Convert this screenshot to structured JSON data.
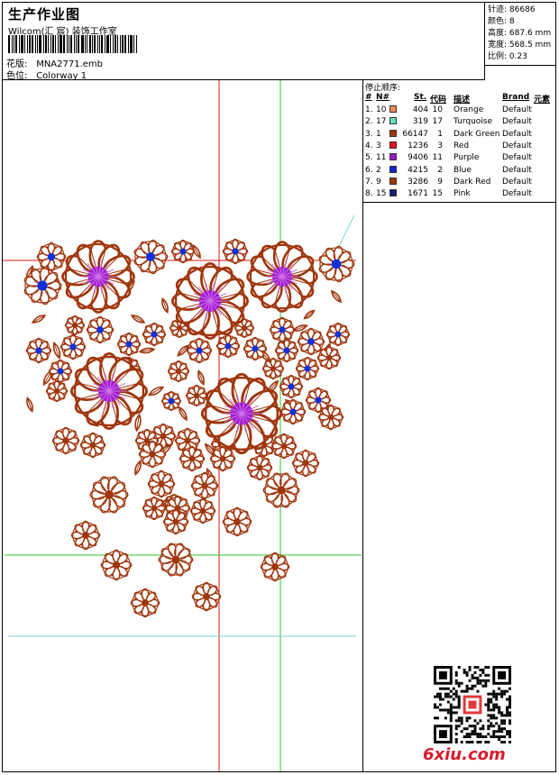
{
  "header": {
    "title": "生产作业图",
    "company": "Wilcom(汇 宸) 装饰工作室",
    "design_label": "花版:",
    "design_value": "MNA2771.emb",
    "colorway_label": "色位:",
    "colorway_value": "Colorway 1"
  },
  "stats": [
    {
      "label": "针迹:",
      "value": "86686"
    },
    {
      "label": "颜色:",
      "value": "8"
    },
    {
      "label": "高度:",
      "value": "687.6 mm"
    },
    {
      "label": "宽度:",
      "value": "568.5 mm"
    },
    {
      "label": "比例:",
      "value": "0.23"
    }
  ],
  "sequence": {
    "title": "停止顺序:",
    "headers": {
      "num": "#",
      "no": "N#",
      "st": "St.",
      "code": "代码",
      "desc": "描述",
      "brand": "Brand",
      "element": "元素"
    },
    "rows": [
      {
        "idx": "1.",
        "no": "10",
        "color": "#f08a5d",
        "st": "404",
        "code": "10",
        "desc": "Orange",
        "brand": "Default"
      },
      {
        "idx": "2.",
        "no": "17",
        "color": "#5fe0c0",
        "st": "319",
        "code": "17",
        "desc": "Turquoise",
        "brand": "Default"
      },
      {
        "idx": "3.",
        "no": "1",
        "color": "#a0360e",
        "st": "66147",
        "code": "1",
        "desc": "Dark Green",
        "brand": "Default"
      },
      {
        "idx": "4.",
        "no": "3",
        "color": "#e8101a",
        "st": "1236",
        "code": "3",
        "desc": "Red",
        "brand": "Default"
      },
      {
        "idx": "5.",
        "no": "11",
        "color": "#9a17c8",
        "st": "9406",
        "code": "11",
        "desc": "Purple",
        "brand": "Default"
      },
      {
        "idx": "6.",
        "no": "2",
        "color": "#1022d8",
        "st": "4215",
        "code": "2",
        "desc": "Blue",
        "brand": "Default"
      },
      {
        "idx": "7.",
        "no": "9",
        "color": "#a0360e",
        "st": "3286",
        "code": "9",
        "desc": "Dark Red",
        "brand": "Default"
      },
      {
        "idx": "8.",
        "no": "15",
        "color": "#14207a",
        "st": "1671",
        "code": "15",
        "desc": "Pink",
        "brand": "Default"
      }
    ]
  },
  "watermark": {
    "logo_text": "6xiu.com"
  },
  "colors": {
    "embroidery": "#a0360e",
    "center_purple": "#a020d0",
    "center_blue": "#1030d8",
    "guide_red": "#e01818",
    "guide_green": "#28c828"
  }
}
